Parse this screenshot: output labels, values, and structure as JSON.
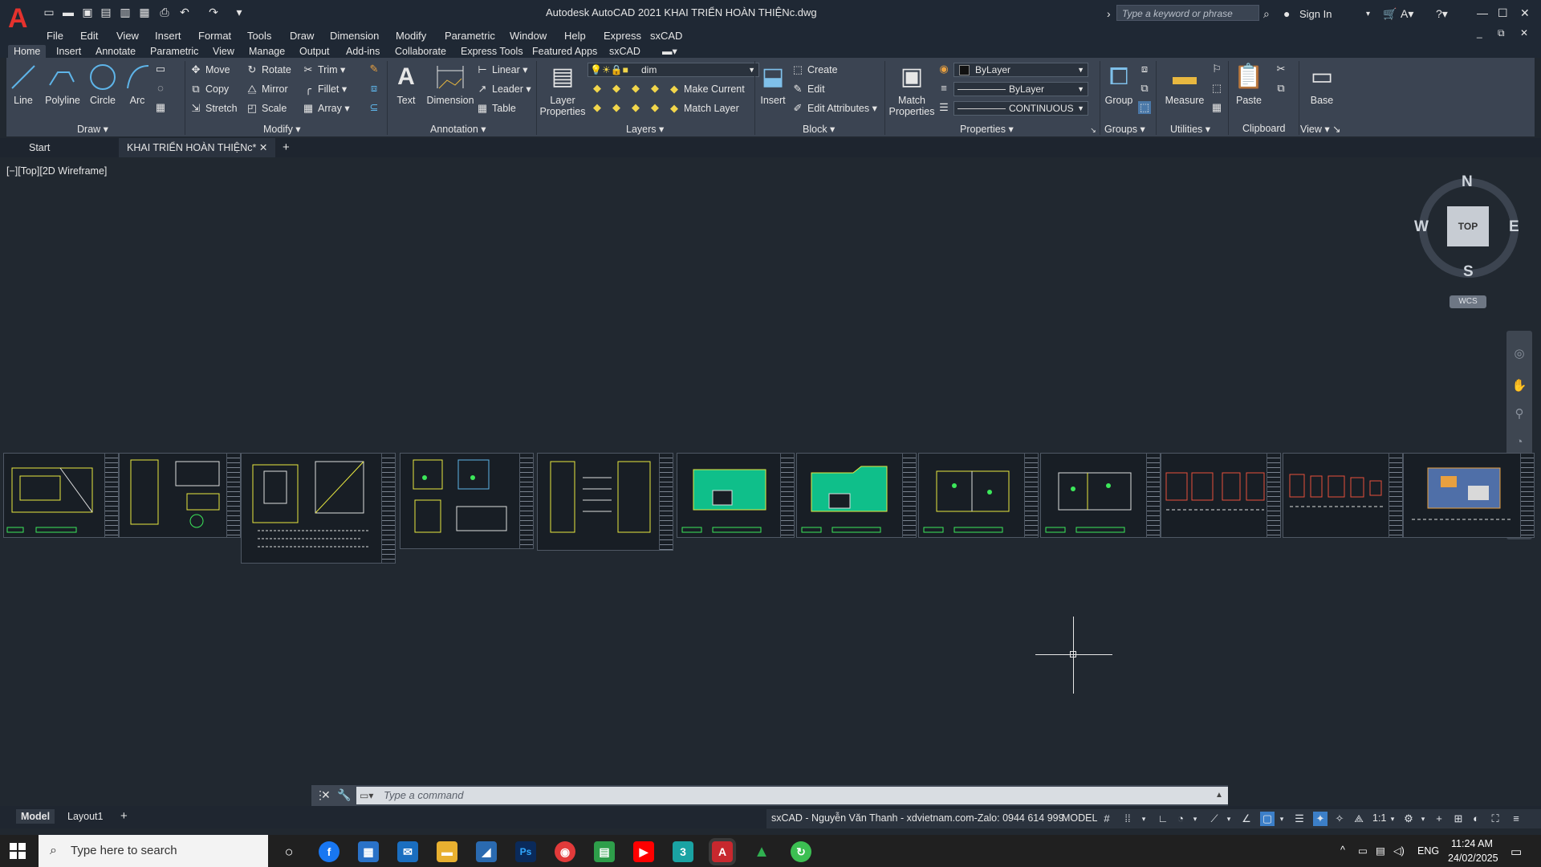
{
  "app": {
    "title": "Autodesk AutoCAD 2021   KHAI TRIỂN HOÀN THIỆNc.dwg",
    "search_placeholder": "Type a keyword or phrase",
    "sign_in": "Sign In",
    "brand_color": "#e5322d"
  },
  "menu": [
    "File",
    "Edit",
    "View",
    "Insert",
    "Format",
    "Tools",
    "Draw",
    "Dimension",
    "Modify",
    "Parametric",
    "Window",
    "Help",
    "Express",
    "sxCAD"
  ],
  "ribbon_tabs": [
    "Home",
    "Insert",
    "Annotate",
    "Parametric",
    "View",
    "Manage",
    "Output",
    "Add-ins",
    "Collaborate",
    "Express Tools",
    "Featured Apps",
    "sxCAD"
  ],
  "ribbon": {
    "draw": {
      "title": "Draw",
      "line": "Line",
      "polyline": "Polyline",
      "circle": "Circle",
      "arc": "Arc"
    },
    "modify": {
      "title": "Modify",
      "move": "Move",
      "rotate": "Rotate",
      "trim": "Trim",
      "copy": "Copy",
      "mirror": "Mirror",
      "fillet": "Fillet",
      "stretch": "Stretch",
      "scale": "Scale",
      "array": "Array"
    },
    "annotation": {
      "title": "Annotation",
      "text": "Text",
      "dimension": "Dimension",
      "linear": "Linear",
      "leader": "Leader",
      "table": "Table"
    },
    "layers": {
      "title": "Layers",
      "layer_properties_1": "Layer",
      "layer_properties_2": "Properties",
      "current_layer": "dim",
      "make_current": "Make Current",
      "match_layer": "Match Layer"
    },
    "block": {
      "title": "Block",
      "insert": "Insert",
      "create": "Create",
      "edit": "Edit",
      "edit_attributes": "Edit Attributes"
    },
    "properties": {
      "title": "Properties",
      "match_1": "Match",
      "match_2": "Properties",
      "color": "ByLayer",
      "lineweight": "ByLayer",
      "linetype": "CONTINUOUS"
    },
    "groups": {
      "title": "Groups",
      "group": "Group"
    },
    "utilities": {
      "title": "Utilities",
      "measure": "Measure"
    },
    "clipboard": {
      "title": "Clipboard",
      "paste": "Paste"
    },
    "view": {
      "title": "View",
      "base": "Base"
    }
  },
  "file_tabs": {
    "start": "Start",
    "active": "KHAI TRIỂN HOÀN THIỆNc*"
  },
  "viewport": {
    "label": "[−][Top][2D Wireframe]",
    "cube": "TOP",
    "n": "N",
    "s": "S",
    "e": "E",
    "w": "W",
    "wcs": "WCS"
  },
  "command": {
    "placeholder": "Type a command"
  },
  "layout_tabs": [
    "Model",
    "Layout1"
  ],
  "status": {
    "info": "sxCAD - Nguyễn Văn Thanh - xdvietnam.com-Zalo: 0944 614 999",
    "model": "MODEL",
    "scale": "1:1"
  },
  "taskbar": {
    "search": "Type here to search",
    "lang": "ENG",
    "time": "11:24 AM",
    "date": "24/02/2025"
  }
}
